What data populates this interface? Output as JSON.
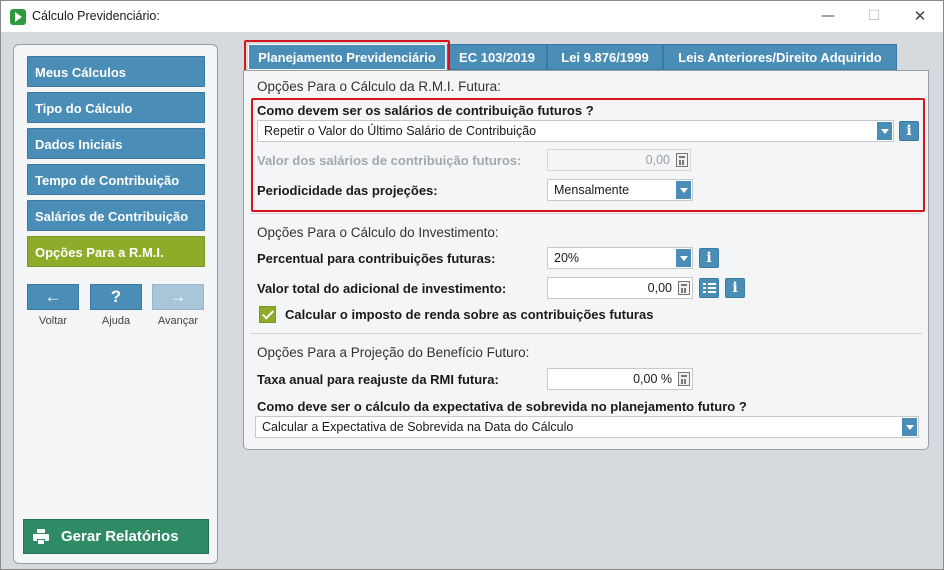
{
  "window": {
    "title": "Cálculo Previdenciário:",
    "minimize_glyph": "—",
    "maximize_glyph": "☐",
    "close_glyph": "✕"
  },
  "sidebar": {
    "items": [
      {
        "label": "Meus Cálculos"
      },
      {
        "label": "Tipo do Cálculo"
      },
      {
        "label": "Dados Iniciais"
      },
      {
        "label": "Tempo de Contribuição"
      },
      {
        "label": "Salários de Contribuição"
      },
      {
        "label": "Opções Para a R.M.I."
      }
    ],
    "toolbar": {
      "back_glyph": "←",
      "back_label": "Voltar",
      "help_glyph": "?",
      "help_label": "Ajuda",
      "forward_glyph": "→",
      "forward_label": "Avançar"
    },
    "report_button_label": "Gerar Relatórios"
  },
  "tabs": [
    {
      "label": "Planejamento Previdenciário"
    },
    {
      "label": "EC 103/2019"
    },
    {
      "label": "Lei 9.876/1999"
    },
    {
      "label": "Leis Anteriores/Direito Adquirido"
    }
  ],
  "section_rmi": {
    "title": "Opções Para o Cálculo da R.M.I. Futura:",
    "future_salaries_question": "Como devem ser os salários de contribuição futuros  ?",
    "future_salaries_option": "Repetir o Valor do Último Salário de Contribuição",
    "future_salaries_value_label": "Valor dos salários de contribuição futuros:",
    "future_salaries_value": "0,00",
    "periodicity_label": "Periodicidade das projeções:",
    "periodicity_value": "Mensalmente"
  },
  "section_investment": {
    "title": "Opções Para o Cálculo do Investimento:",
    "percent_label": "Percentual para contribuições futuras:",
    "percent_value": "20%",
    "additional_label": "Valor total do adicional de investimento:",
    "additional_value": "0,00",
    "income_tax_label": "Calcular o imposto de renda sobre as contribuições futuras"
  },
  "section_projection": {
    "title": "Opções Para a Projeção do Benefício Futuro:",
    "annual_rate_label": "Taxa anual para reajuste da RMI futura:",
    "annual_rate_value": "0,00 %",
    "survival_question": "Como deve ser o cálculo da expectativa de sobrevida no planejamento futuro ?",
    "survival_option": "Calcular a Expectativa de Sobrevida na Data do Cálculo"
  },
  "colors": {
    "accent_blue": "#4a8db6",
    "accent_green": "#8cac2a",
    "report_green": "#2f8a66",
    "highlight_red": "#d7141d"
  }
}
